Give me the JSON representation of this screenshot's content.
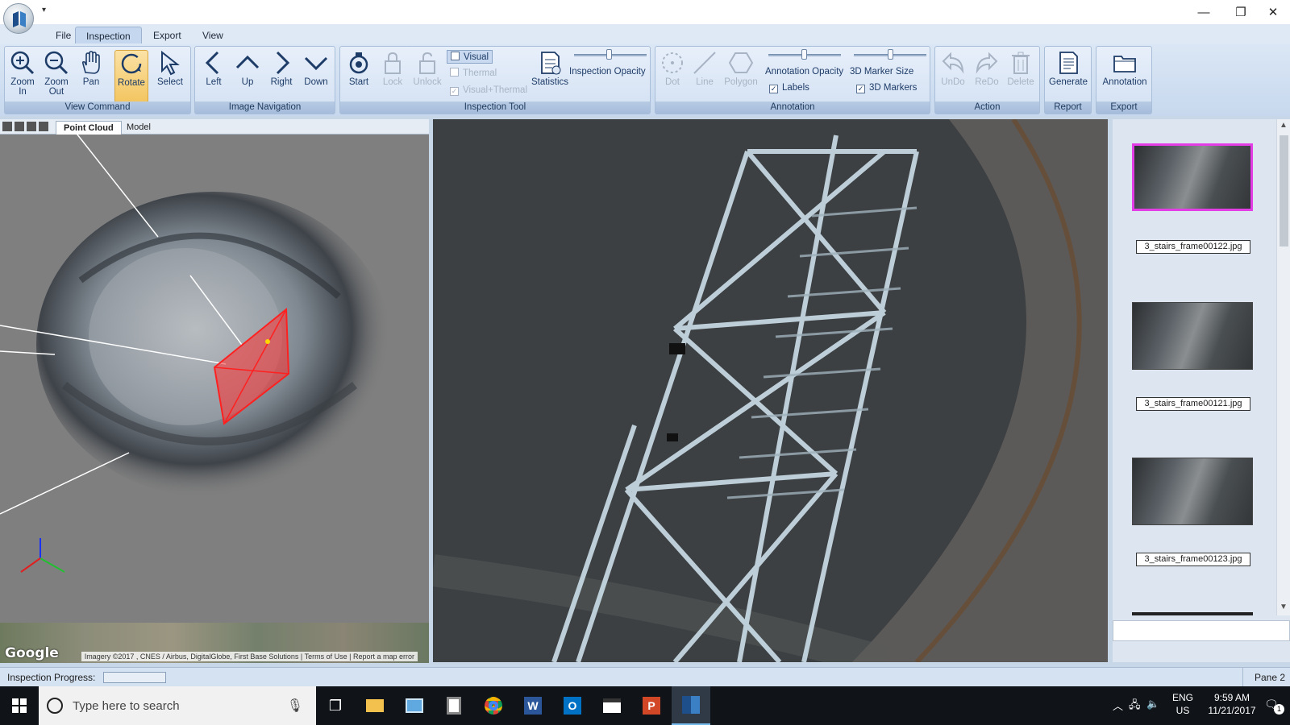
{
  "menu": {
    "tabs": [
      "File",
      "Inspection",
      "Export",
      "View"
    ],
    "active": "Inspection"
  },
  "ribbon": {
    "view_command": {
      "title": "View Command",
      "buttons": [
        "Zoom In",
        "Zoom Out",
        "Pan",
        "Rotate",
        "Select"
      ],
      "selected": "Rotate"
    },
    "image_navigation": {
      "title": "Image Navigation",
      "buttons": [
        "Left",
        "Up",
        "Right",
        "Down"
      ]
    },
    "inspection_tool": {
      "title": "Inspection Tool",
      "start": "Start",
      "lock": "Lock",
      "unlock": "Unlock",
      "visual": "Visual",
      "thermal": "Thermal",
      "visual_thermal": "Visual+Thermal",
      "statistics": "Statistics",
      "opacity_label": "Inspection Opacity"
    },
    "annotation": {
      "title": "Annotation",
      "dot": "Dot",
      "line": "Line",
      "polygon": "Polygon",
      "opacity_label": "Annotation Opacity",
      "marker_size_label": "3D Marker Size",
      "labels_check": "Labels",
      "markers_check": "3D Markers"
    },
    "action": {
      "title": "Action",
      "undo": "UnDo",
      "redo": "ReDo",
      "delete": "Delete"
    },
    "report": {
      "title": "Report",
      "generate": "Generate"
    },
    "export": {
      "title": "Export",
      "annotation": "Annotation"
    }
  },
  "left_pane": {
    "tabs": [
      "Point Cloud",
      "Model"
    ],
    "active_tab": "Point Cloud",
    "map_attribution": "Imagery ©2017 , CNES / Airbus, DigitalGlobe, First Base Solutions | Terms of Use | Report a map error",
    "map_brand": "Google"
  },
  "thumbnails": [
    {
      "label": "3_stairs_frame00122.jpg",
      "selected": true
    },
    {
      "label": "3_stairs_frame00121.jpg",
      "selected": false
    },
    {
      "label": "3_stairs_frame00123.jpg",
      "selected": false
    }
  ],
  "status": {
    "progress_label": "Inspection Progress:",
    "pane_label": "Pane 2",
    "progress_value": 0
  },
  "taskbar": {
    "search_placeholder": "Type here to search",
    "lang": "ENG",
    "region": "US",
    "time": "9:59 AM",
    "date": "11/21/2017",
    "notification_count": "1"
  },
  "colors": {
    "ribbon": "#d3e1f3",
    "selected_thumb": "#e33de6",
    "annotation": "#ff3030"
  }
}
